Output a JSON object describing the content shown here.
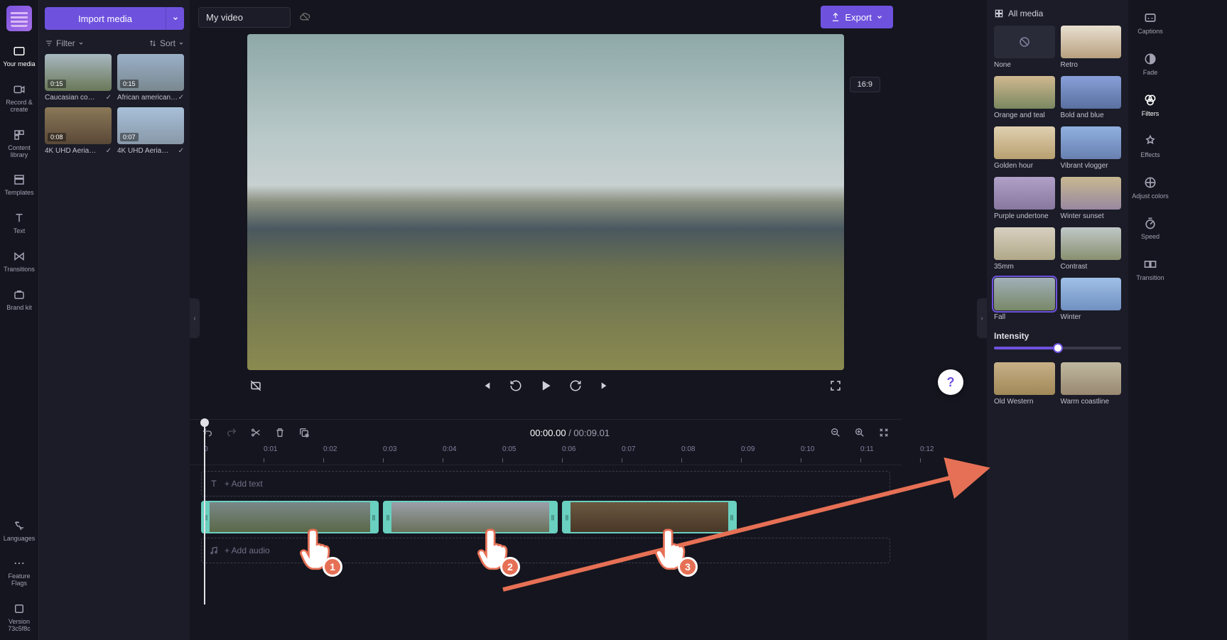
{
  "header": {
    "title_value": "My video",
    "aspect_ratio": "16:9",
    "export_label": "Export",
    "import_label": "Import media"
  },
  "left_rail": [
    {
      "id": "your-media",
      "label": "Your media",
      "active": true
    },
    {
      "id": "record-create",
      "label": "Record & create"
    },
    {
      "id": "content-library",
      "label": "Content library"
    },
    {
      "id": "templates",
      "label": "Templates"
    },
    {
      "id": "text",
      "label": "Text"
    },
    {
      "id": "transitions",
      "label": "Transitions"
    },
    {
      "id": "brand-kit",
      "label": "Brand kit"
    }
  ],
  "left_rail_bottom": [
    {
      "id": "languages",
      "label": "Languages"
    },
    {
      "id": "feature-flags",
      "label": "Feature Flags"
    },
    {
      "id": "version",
      "label": "Version 73c5f8c"
    }
  ],
  "media_panel": {
    "filter_label": "Filter",
    "sort_label": "Sort",
    "clips": [
      {
        "duration": "0:15",
        "title": "Caucasian co…"
      },
      {
        "duration": "0:15",
        "title": "African american…"
      },
      {
        "duration": "0:08",
        "title": "4K UHD Aeria…"
      },
      {
        "duration": "0:07",
        "title": "4K UHD Aeria…"
      }
    ]
  },
  "timeline": {
    "time_current": "00:00.00",
    "time_total": "00:09.01",
    "add_text": "+ Add text",
    "add_audio": "+ Add audio",
    "ruler": [
      "0",
      "0:01",
      "0:02",
      "0:03",
      "0:04",
      "0:05",
      "0:06",
      "0:07",
      "0:08",
      "0:09",
      "0:10",
      "0:11",
      "0:12"
    ]
  },
  "filters_panel": {
    "header": "All media",
    "intensity_label": "Intensity",
    "intensity_value": 50,
    "filters": [
      {
        "name": "None"
      },
      {
        "name": "Retro"
      },
      {
        "name": "Orange and teal"
      },
      {
        "name": "Bold and blue"
      },
      {
        "name": "Golden hour"
      },
      {
        "name": "Vibrant vlogger"
      },
      {
        "name": "Purple undertone"
      },
      {
        "name": "Winter sunset"
      },
      {
        "name": "35mm"
      },
      {
        "name": "Contrast"
      },
      {
        "name": "Fall",
        "selected": true
      },
      {
        "name": "Winter"
      },
      {
        "name": "Old Western"
      },
      {
        "name": "Warm coastline"
      }
    ]
  },
  "right_rail": [
    {
      "id": "captions",
      "label": "Captions"
    },
    {
      "id": "fade",
      "label": "Fade"
    },
    {
      "id": "filters",
      "label": "Filters",
      "active": true
    },
    {
      "id": "effects",
      "label": "Effects"
    },
    {
      "id": "adjust-colors",
      "label": "Adjust colors"
    },
    {
      "id": "speed",
      "label": "Speed"
    },
    {
      "id": "transition",
      "label": "Transition"
    }
  ],
  "annotations": {
    "pointers": [
      "1",
      "2",
      "3"
    ]
  },
  "help_label": "?",
  "colors": {
    "accent": "#6e52de",
    "annotation": "#e67055",
    "clip_border": "#6ad0c0"
  }
}
